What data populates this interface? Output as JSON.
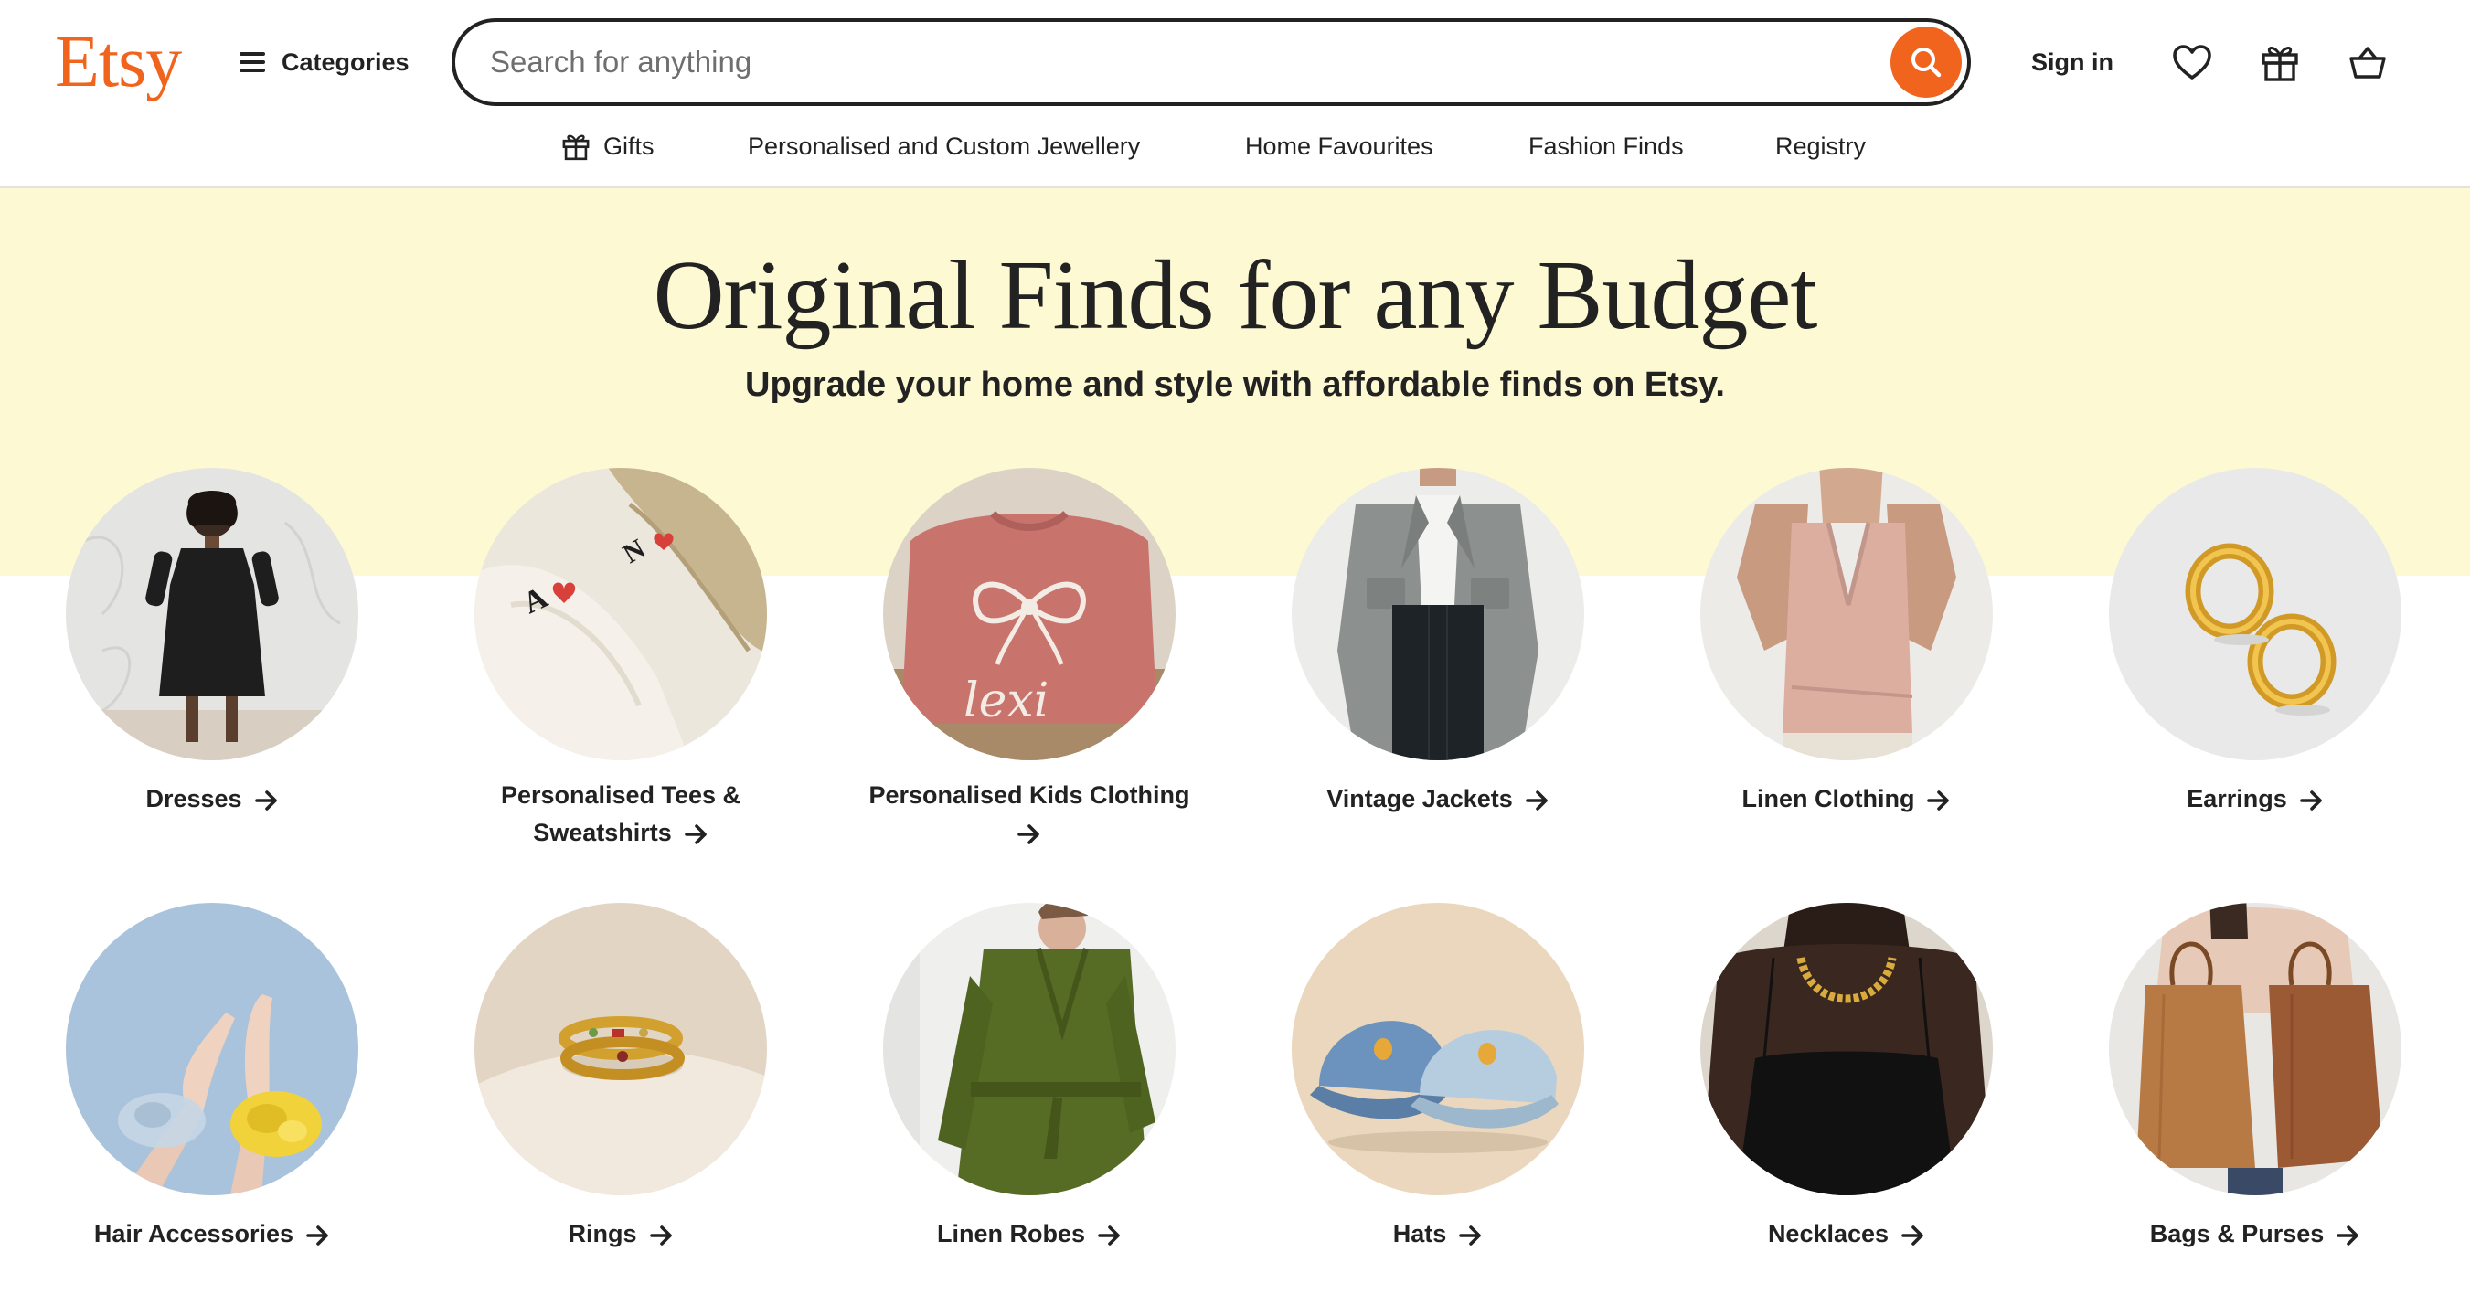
{
  "header": {
    "logo": "Etsy",
    "categories_label": "Categories",
    "search_placeholder": "Search for anything",
    "signin_label": "Sign in"
  },
  "subnav": {
    "items": [
      {
        "label": "Gifts",
        "icon": "gift-icon"
      },
      {
        "label": "Personalised and Custom Jewellery"
      },
      {
        "label": "Home Favourites"
      },
      {
        "label": "Fashion Finds"
      },
      {
        "label": "Registry"
      }
    ]
  },
  "hero": {
    "title": "Original Finds for any Budget",
    "subtitle": "Upgrade your home and style with affordable finds on Etsy."
  },
  "categories": [
    {
      "line1": "Dresses",
      "line2": "",
      "image": "black-dress-photo"
    },
    {
      "line1": "Personalised Tees &",
      "line2": "Sweatshirts",
      "image": "embroidered-sweatshirts-photo"
    },
    {
      "line1": "Personalised Kids Clothing",
      "line2": "",
      "image": "pink-bow-sweatshirt-photo"
    },
    {
      "line1": "Vintage Jackets",
      "line2": "",
      "image": "grey-jacket-photo"
    },
    {
      "line1": "Linen Clothing",
      "line2": "",
      "image": "pink-linen-vest-photo"
    },
    {
      "line1": "Earrings",
      "line2": "",
      "image": "gold-hoop-earrings-photo"
    },
    {
      "line1": "Hair Accessories",
      "line2": "",
      "image": "scrunchies-photo"
    },
    {
      "line1": "Rings",
      "line2": "",
      "image": "gold-rings-photo"
    },
    {
      "line1": "Linen Robes",
      "line2": "",
      "image": "green-robe-photo"
    },
    {
      "line1": "Hats",
      "line2": "",
      "image": "denim-caps-photo"
    },
    {
      "line1": "Necklaces",
      "line2": "",
      "image": "gold-chain-necklace-photo"
    },
    {
      "line1": "Bags & Purses",
      "line2": "",
      "image": "leather-totes-photo"
    }
  ],
  "colors": {
    "brand": "#F1641E",
    "hero_background": "#FDF9D2",
    "text": "#222222"
  }
}
